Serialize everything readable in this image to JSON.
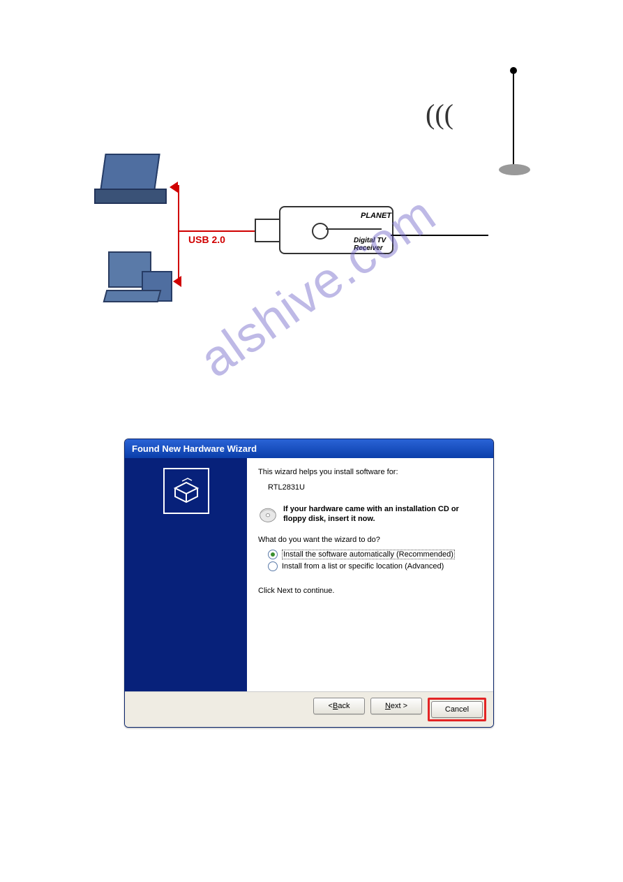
{
  "diagram": {
    "usb_label": "USB 2.0",
    "device_brand": "PLANET",
    "device_subtitle": "Digital TV Receiver",
    "waves": "((("
  },
  "watermark": "alshive.com",
  "wizard": {
    "title": "Found New Hardware Wizard",
    "intro": "This wizard helps you install software for:",
    "device_name": "RTL2831U",
    "cd_prompt": "If your hardware came with an installation CD or floppy disk, insert it now.",
    "question": "What do you want the wizard to do?",
    "options": [
      {
        "label": "Install the software automatically (Recommended)",
        "selected": true
      },
      {
        "label": "Install from a list or specific location (Advanced)",
        "selected": false
      }
    ],
    "continue_text": "Click Next to continue.",
    "buttons": {
      "back_prefix": "< ",
      "back_u": "B",
      "back_rest": "ack",
      "next_u": "N",
      "next_rest": "ext >",
      "cancel": "Cancel"
    }
  }
}
